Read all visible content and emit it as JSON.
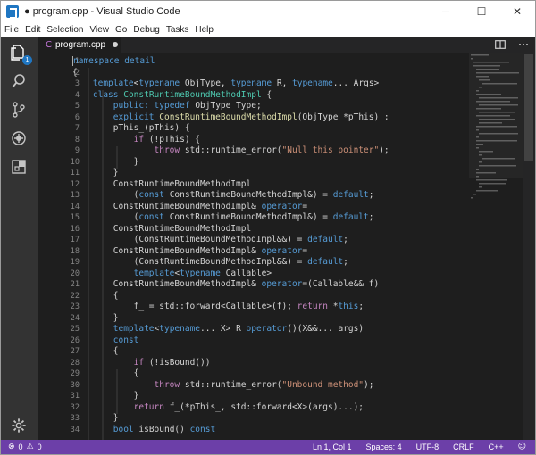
{
  "window": {
    "title": "● program.cpp - Visual Studio Code",
    "minimize": "─",
    "maximize": "☐",
    "close": "✕"
  },
  "menu": [
    "File",
    "Edit",
    "Selection",
    "View",
    "Go",
    "Debug",
    "Tasks",
    "Help"
  ],
  "activity": {
    "explorer_badge": "1"
  },
  "tab": {
    "icon": "C",
    "label": "program.cpp"
  },
  "colors": {
    "keyword": "#569cd6",
    "control": "#c586c0",
    "type": "#4ec9b0",
    "function": "#dcdcaa",
    "string": "#ce9178",
    "variable": "#9cdcfe",
    "plain": "#d4d4d4",
    "status_bar": "#6c3fa8"
  },
  "line_numbers": [
    "1",
    "2",
    "3",
    "4",
    "5",
    "6",
    "7",
    "8",
    "9",
    "10",
    "11",
    "12",
    "13",
    "14",
    "15",
    "16",
    "17",
    "18",
    "19",
    "20",
    "21",
    "22",
    "23",
    "24",
    "25",
    "26",
    "27",
    "28",
    "29",
    "30",
    "31",
    "32",
    "33",
    "34"
  ],
  "code_lines": [
    [
      [
        "namespace detail",
        "keyword"
      ]
    ],
    [
      [
        "{",
        "plain"
      ]
    ],
    [
      [
        "    ",
        "plain"
      ],
      [
        "template",
        "keyword"
      ],
      [
        "<",
        "plain"
      ],
      [
        "typename",
        "keyword"
      ],
      [
        " ObjType, ",
        "plain"
      ],
      [
        "typename",
        "keyword"
      ],
      [
        " R, ",
        "plain"
      ],
      [
        "typename",
        "keyword"
      ],
      [
        "... Args>",
        "plain"
      ]
    ],
    [
      [
        "    ",
        "plain"
      ],
      [
        "class",
        "keyword"
      ],
      [
        " ",
        "plain"
      ],
      [
        "ConstRuntimeBoundMethodImpl",
        "type"
      ],
      [
        " {",
        "plain"
      ]
    ],
    [
      [
        "        ",
        "plain"
      ],
      [
        "public:",
        "keyword"
      ],
      [
        " ",
        "plain"
      ],
      [
        "typedef",
        "keyword"
      ],
      [
        " ObjType Type;",
        "plain"
      ]
    ],
    [
      [
        "        ",
        "plain"
      ],
      [
        "explicit",
        "keyword"
      ],
      [
        " ",
        "plain"
      ],
      [
        "ConstRuntimeBoundMethodImpl",
        "function"
      ],
      [
        "(ObjType *pThis) :",
        "plain"
      ]
    ],
    [
      [
        "        pThis_(pThis) {",
        "plain"
      ]
    ],
    [
      [
        "            ",
        "plain"
      ],
      [
        "if",
        "control"
      ],
      [
        " (!pThis) {",
        "plain"
      ]
    ],
    [
      [
        "                ",
        "plain"
      ],
      [
        "throw",
        "control"
      ],
      [
        " std::runtime_error(",
        "plain"
      ],
      [
        "\"Null this pointer\"",
        "string"
      ],
      [
        ");",
        "plain"
      ]
    ],
    [
      [
        "            }",
        "plain"
      ]
    ],
    [
      [
        "        }",
        "plain"
      ]
    ],
    [
      [
        "        ConstRuntimeBoundMethodImpl",
        "plain"
      ]
    ],
    [
      [
        "            (",
        "plain"
      ],
      [
        "const",
        "keyword"
      ],
      [
        " ConstRuntimeBoundMethodImpl&) = ",
        "plain"
      ],
      [
        "default",
        "keyword"
      ],
      [
        ";",
        "plain"
      ]
    ],
    [
      [
        "        ConstRuntimeBoundMethodImpl& ",
        "plain"
      ],
      [
        "operator",
        "keyword"
      ],
      [
        "=",
        "plain"
      ]
    ],
    [
      [
        "            (",
        "plain"
      ],
      [
        "const",
        "keyword"
      ],
      [
        " ConstRuntimeBoundMethodImpl&) = ",
        "plain"
      ],
      [
        "default",
        "keyword"
      ],
      [
        ";",
        "plain"
      ]
    ],
    [
      [
        "        ConstRuntimeBoundMethodImpl",
        "plain"
      ]
    ],
    [
      [
        "            (ConstRuntimeBoundMethodImpl&&) = ",
        "plain"
      ],
      [
        "default",
        "keyword"
      ],
      [
        ";",
        "plain"
      ]
    ],
    [
      [
        "        ConstRuntimeBoundMethodImpl& ",
        "plain"
      ],
      [
        "operator",
        "keyword"
      ],
      [
        "=",
        "plain"
      ]
    ],
    [
      [
        "            (ConstRuntimeBoundMethodImpl&&) = ",
        "plain"
      ],
      [
        "default",
        "keyword"
      ],
      [
        ";",
        "plain"
      ]
    ],
    [
      [
        "            ",
        "plain"
      ],
      [
        "template",
        "keyword"
      ],
      [
        "<",
        "plain"
      ],
      [
        "typename",
        "keyword"
      ],
      [
        " Callable>",
        "plain"
      ]
    ],
    [
      [
        "        ConstRuntimeBoundMethodImpl& ",
        "plain"
      ],
      [
        "operator",
        "keyword"
      ],
      [
        "=(Callable&& f)",
        "plain"
      ]
    ],
    [
      [
        "        {",
        "plain"
      ]
    ],
    [
      [
        "            f_ = std::forward<Callable>(f); ",
        "plain"
      ],
      [
        "return",
        "control"
      ],
      [
        " *",
        "plain"
      ],
      [
        "this",
        "keyword"
      ],
      [
        ";",
        "plain"
      ]
    ],
    [
      [
        "        }",
        "plain"
      ]
    ],
    [
      [
        "        ",
        "plain"
      ],
      [
        "template",
        "keyword"
      ],
      [
        "<",
        "plain"
      ],
      [
        "typename",
        "keyword"
      ],
      [
        "... X> R ",
        "plain"
      ],
      [
        "operator",
        "keyword"
      ],
      [
        "()(X&&... args)",
        "plain"
      ]
    ],
    [
      [
        "        ",
        "plain"
      ],
      [
        "const",
        "keyword"
      ]
    ],
    [
      [
        "        {",
        "plain"
      ]
    ],
    [
      [
        "            ",
        "plain"
      ],
      [
        "if",
        "control"
      ],
      [
        " (!isBound())",
        "plain"
      ]
    ],
    [
      [
        "            {",
        "plain"
      ]
    ],
    [
      [
        "                ",
        "plain"
      ],
      [
        "throw",
        "control"
      ],
      [
        " std::runtime_error(",
        "plain"
      ],
      [
        "\"Unbound method\"",
        "string"
      ],
      [
        ");",
        "plain"
      ]
    ],
    [
      [
        "            }",
        "plain"
      ]
    ],
    [
      [
        "            ",
        "plain"
      ],
      [
        "return",
        "control"
      ],
      [
        " f_(*pThis_, std::forward<X>(args)...);",
        "plain"
      ]
    ],
    [
      [
        "        }",
        "plain"
      ]
    ],
    [
      [
        "        ",
        "plain"
      ],
      [
        "bool",
        "keyword"
      ],
      [
        " isBound() ",
        "plain"
      ],
      [
        "const",
        "keyword"
      ]
    ]
  ],
  "status": {
    "errors": "0",
    "warnings": "0",
    "position": "Ln 1, Col 1",
    "spaces": "Spaces: 4",
    "encoding": "UTF-8",
    "eol": "CRLF",
    "language": "C++"
  }
}
